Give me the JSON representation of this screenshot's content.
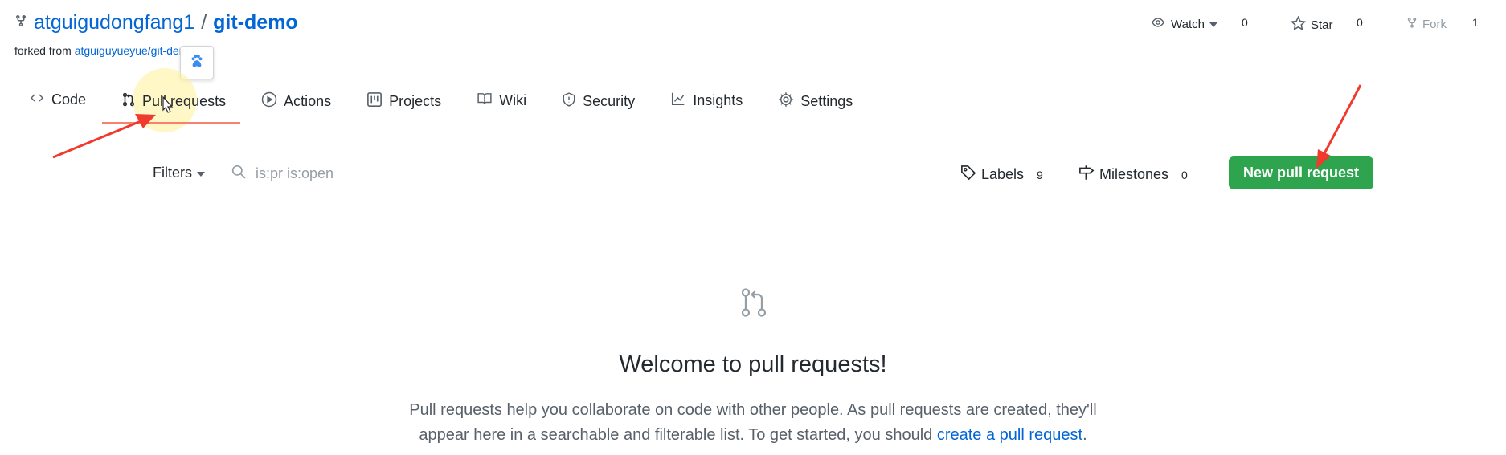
{
  "repo": {
    "owner": "atguigudongfang1",
    "separator": "/",
    "name": "git-demo",
    "forked_prefix": "forked from ",
    "forked_link": "atguiguyueyue/git-demo",
    "icon": "repo-forked-icon"
  },
  "actions": {
    "watch": {
      "label": "Watch",
      "count": "0",
      "icon": "eye-icon"
    },
    "star": {
      "label": "Star",
      "count": "0",
      "icon": "star-icon"
    },
    "fork": {
      "label": "Fork",
      "count": "1",
      "icon": "repo-forked-icon"
    }
  },
  "tabs": [
    {
      "label": "Code",
      "icon": "code-icon"
    },
    {
      "label": "Pull requests",
      "icon": "git-pull-request-icon",
      "selected": true
    },
    {
      "label": "Actions",
      "icon": "play-icon"
    },
    {
      "label": "Projects",
      "icon": "project-icon"
    },
    {
      "label": "Wiki",
      "icon": "book-icon"
    },
    {
      "label": "Security",
      "icon": "shield-icon"
    },
    {
      "label": "Insights",
      "icon": "graph-icon"
    },
    {
      "label": "Settings",
      "icon": "gear-icon"
    }
  ],
  "toolbar": {
    "filters_label": "Filters",
    "search_value": "is:pr is:open",
    "labels_label": "Labels",
    "labels_count": "9",
    "milestones_label": "Milestones",
    "milestones_count": "0",
    "new_pr_label": "New pull request"
  },
  "blankslate": {
    "title": "Welcome to pull requests!",
    "desc_line1": "Pull requests help you collaborate on code with other people. As pull requests are created, they'll",
    "desc_line2": "appear here in a searchable and filterable list. To get started, you should ",
    "link": "create a pull request",
    "desc_end": "."
  },
  "colors": {
    "primary_button": "#2ea44f",
    "link": "#0366d6",
    "selected_tab_underline": "#f9826c",
    "annotation_arrow": "#f03a2e"
  }
}
